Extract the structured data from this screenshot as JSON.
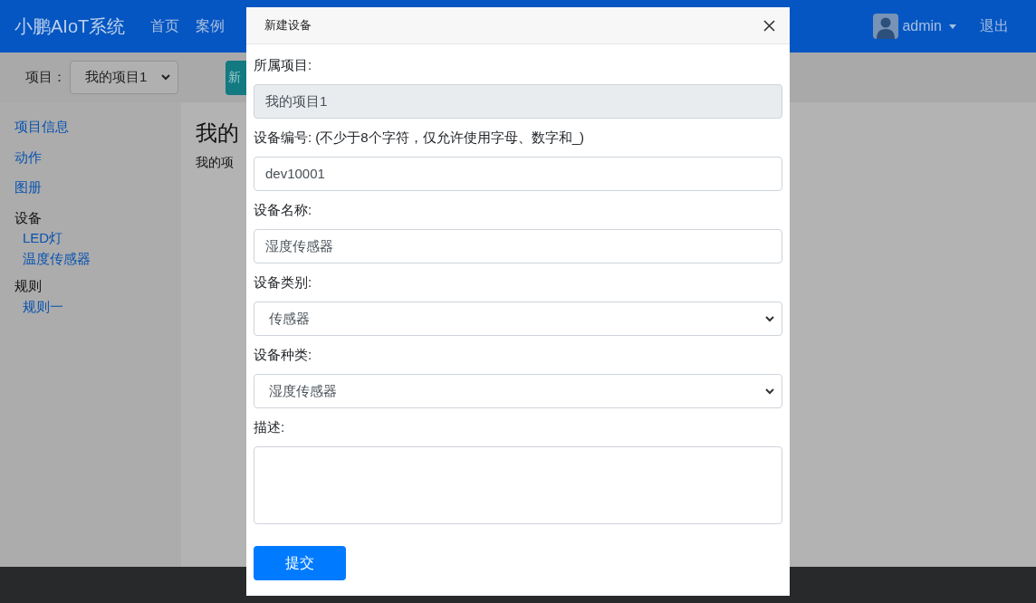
{
  "navbar": {
    "brand": "小鹏AIoT系统",
    "links": [
      "首页",
      "案例"
    ],
    "user": "admin",
    "logout": "退出"
  },
  "toolbar": {
    "project_label": "项目：",
    "project_select": "我的项目1",
    "button": "新"
  },
  "sidebar": [
    {
      "label": "项目信息",
      "kind": "link"
    },
    {
      "label": "动作",
      "kind": "link"
    },
    {
      "label": "图册",
      "kind": "link"
    },
    {
      "label": "设备",
      "kind": "header",
      "children": [
        {
          "label": "LED灯"
        },
        {
          "label": "温度传感器"
        }
      ]
    },
    {
      "label": "规则",
      "kind": "header",
      "children": [
        {
          "label": "规则一"
        }
      ]
    }
  ],
  "main": {
    "heading": "我的",
    "text": "我的项"
  },
  "modal": {
    "title": "新建设备",
    "fields": [
      {
        "label": "所属项目:",
        "kind": "readonly",
        "value": "我的项目1"
      },
      {
        "label": "设备编号: (不少于8个字符，仅允许使用字母、数字和_)",
        "kind": "input",
        "value": "dev10001"
      },
      {
        "label": "设备名称:",
        "kind": "input",
        "value": "湿度传感器"
      },
      {
        "label": "设备类别:",
        "kind": "select",
        "value": "传感器"
      },
      {
        "label": "设备种类:",
        "kind": "select",
        "value": "湿度传感器"
      },
      {
        "label": "描述:",
        "kind": "textarea"
      }
    ],
    "submit": "提交"
  }
}
